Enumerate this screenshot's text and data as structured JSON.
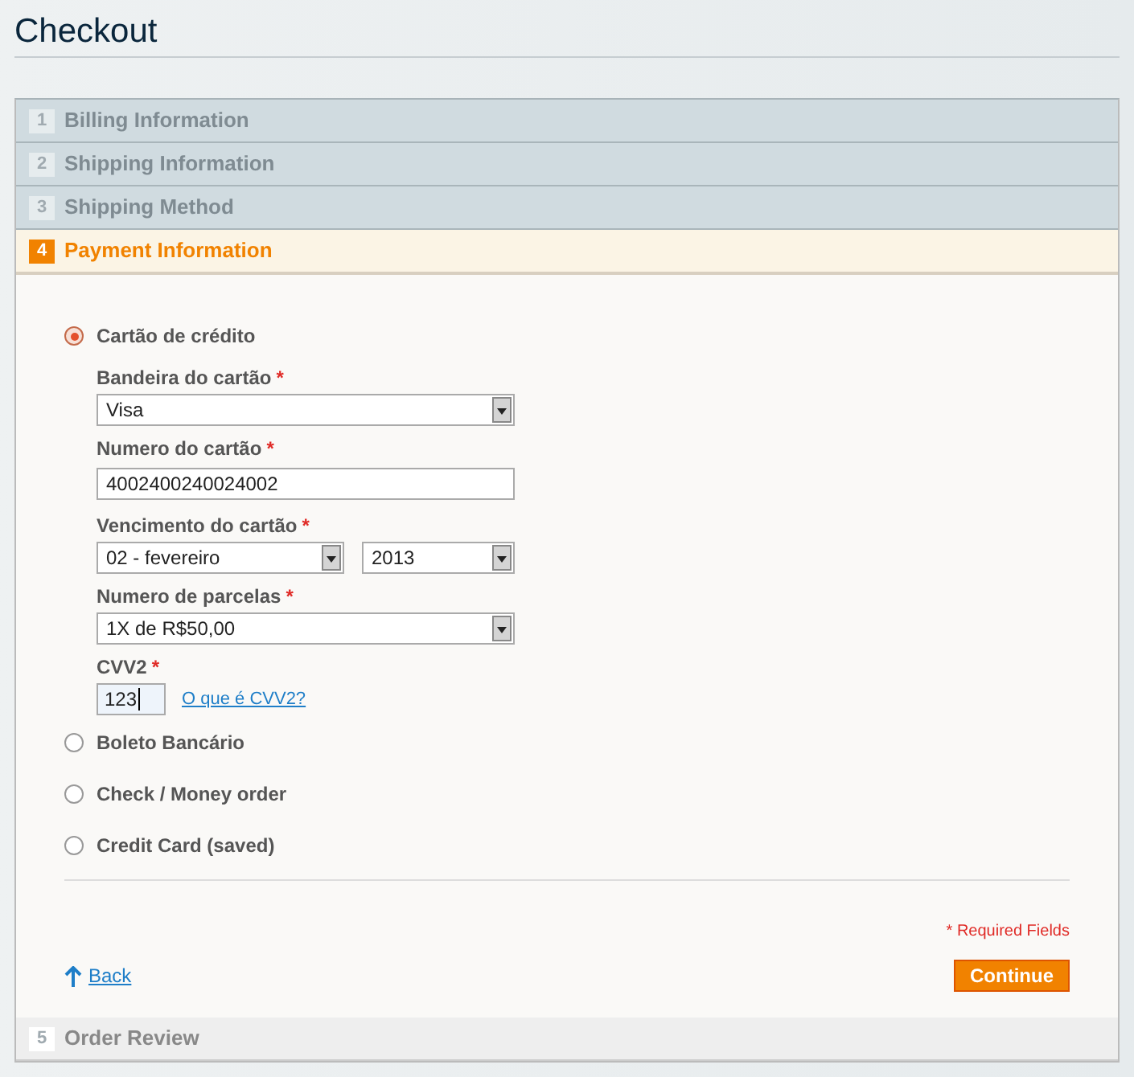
{
  "title": "Checkout",
  "steps": [
    {
      "number": "1",
      "label": "Billing Information",
      "selected": false,
      "allowed": true
    },
    {
      "number": "2",
      "label": "Shipping Information",
      "selected": false,
      "allowed": true
    },
    {
      "number": "3",
      "label": "Shipping Method",
      "selected": false,
      "allowed": true
    },
    {
      "number": "4",
      "label": "Payment Information",
      "selected": true,
      "allowed": true
    },
    {
      "number": "5",
      "label": "Order Review",
      "selected": false,
      "allowed": false
    }
  ],
  "payment_methods": [
    {
      "label": "Cartão de crédito",
      "selected": true,
      "fields": [
        {
          "kind": "select",
          "label": "Bandeira do cartão",
          "required_mark": "*",
          "value": "Visa"
        },
        {
          "kind": "text",
          "label": "Numero do cartão",
          "required_mark": "*",
          "value": "4002400240024002"
        },
        {
          "kind": "select_pair",
          "label": "Vencimento do cartão",
          "required_mark": "*",
          "values": [
            "02 - fevereiro",
            "2013"
          ]
        },
        {
          "kind": "select",
          "label": "Numero de parcelas",
          "required_mark": "*",
          "value": "1X de R$50,00"
        },
        {
          "kind": "cvv",
          "label": "CVV2",
          "required_mark": "*",
          "value": "123",
          "link": "O que é CVV2?"
        }
      ]
    },
    {
      "label": "Boleto Bancário",
      "selected": false
    },
    {
      "label": "Check / Money order",
      "selected": false
    },
    {
      "label": "Credit Card (saved)",
      "selected": false
    }
  ],
  "required_note": "* Required Fields",
  "back_link": "Back",
  "continue_button": "Continue"
}
